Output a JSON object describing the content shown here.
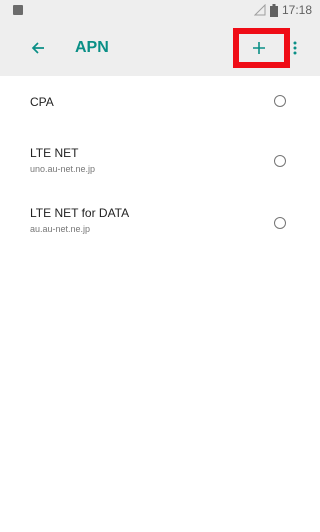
{
  "status_bar": {
    "time": "17:18"
  },
  "toolbar": {
    "title": "APN",
    "back_icon": "arrow-back-icon",
    "add_icon": "plus-icon",
    "overflow_icon": "more-vert-icon"
  },
  "apn_list": [
    {
      "name": "CPA",
      "apn": ""
    },
    {
      "name": "LTE NET",
      "apn": "uno.au-net.ne.jp"
    },
    {
      "name": "LTE NET for DATA",
      "apn": "au.au-net.ne.jp"
    }
  ],
  "colors": {
    "accent": "#0a8f86",
    "highlight": "#ef0c16",
    "toolbar_bg": "#eeeeee"
  }
}
